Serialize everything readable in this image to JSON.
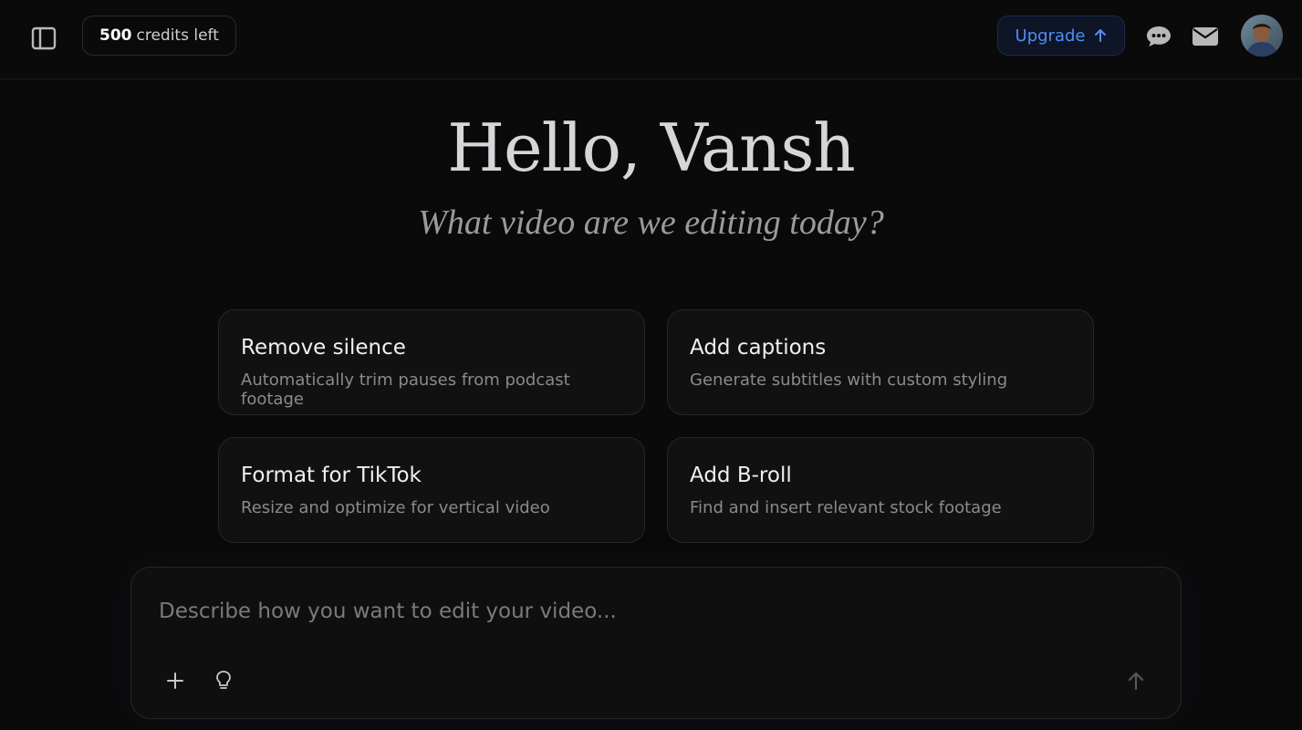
{
  "header": {
    "credits_count": "500",
    "credits_label": "credits left",
    "upgrade_label": "Upgrade",
    "icons": [
      "sidebar-toggle-icon",
      "chat-icon",
      "mail-icon",
      "user-avatar"
    ]
  },
  "hero": {
    "greeting": "Hello, Vansh",
    "subtitle": "What video are we editing today?"
  },
  "suggestions": [
    {
      "title": "Remove silence",
      "description": "Automatically trim pauses from podcast footage"
    },
    {
      "title": "Add captions",
      "description": "Generate subtitles with custom styling"
    },
    {
      "title": "Format for TikTok",
      "description": "Resize and optimize for vertical video"
    },
    {
      "title": "Add B-roll",
      "description": "Find and insert relevant stock footage"
    }
  ],
  "composer": {
    "placeholder": "Describe how you want to edit your video...",
    "value": ""
  },
  "colors": {
    "background": "#0a0a0a",
    "accent": "#4f8ef7",
    "card_bg": "#111111"
  }
}
